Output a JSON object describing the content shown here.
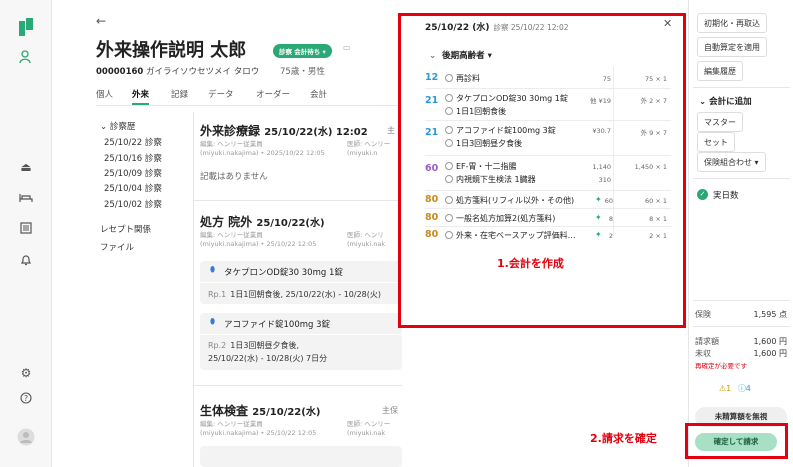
{
  "patient": {
    "back_icon": "←",
    "name": "外来操作説明 太郎",
    "status_badge": "診察 会計待ち ▾",
    "id": "00000160",
    "kana": "ガイライソウセツメイ タロウ",
    "age_sex": "75歳・男性"
  },
  "tabs": [
    "個人",
    "外来",
    "記録",
    "データ",
    "オーダー",
    "会計"
  ],
  "history": {
    "title": "診察歴",
    "items": [
      "25/10/22 診察",
      "25/10/16 診察",
      "25/10/09 診察",
      "25/10/04 診察",
      "25/10/02 診察"
    ],
    "links": [
      "レセプト関係",
      "ファイル"
    ]
  },
  "records": {
    "visit_title": "外来診療録",
    "visit_date": "25/10/22(水) 12:02",
    "visit_meta_left": "編集: ヘンリー従業員\n(miyuki.nakajima) • 2025/10/22 12:05",
    "visit_meta_right": "医師: ヘンリー\n(miyuki.n",
    "visit_trunc": "主",
    "no_record": "記載はありません",
    "rx_title": "処方 院外",
    "rx_date": "25/10/22(水)",
    "rx_meta_left": "編集: ヘンリー従業員\n(miyuki.nakajima) • 25/10/22 12:05",
    "rx_meta_right": "医師: ヘンリ\n(miyuki.nak",
    "rx1_drug": "タケプロンOD錠30 30mg 1錠",
    "rx1_line": "1日1回朝食後, 25/10/22(水) - 10/28(火)",
    "rx1_rp": "Rp.1",
    "rx2_drug": "アコファイド錠100mg 3錠",
    "rx2_rp": "Rp.2",
    "rx2_line1": "1日3回朝昼夕食後,",
    "rx2_line2": "25/10/22(水) - 10/28(火) 7日分",
    "lab_title": "生体検査",
    "lab_date": "25/10/22(水)",
    "lab_meta_left": "編集: ヘンリー従業員\n(miyuki.nakajima) • 25/10/22 12:05",
    "lab_meta_right": "医師: ヘンリー\n(miyuki.nak",
    "lab_trunc": "主保"
  },
  "billing_panel": {
    "date": "25/10/22 (水)",
    "sub": "診察 25/10/22 12:02",
    "close": "✕",
    "insurance": "後期高齢者 ▾",
    "items": [
      {
        "pts": "12",
        "pts_color": "#2b9bd8",
        "name": "再診料",
        "price": "75",
        "mult": "75 × 1"
      },
      {
        "pts": "21",
        "pts_color": "#2b9bd8",
        "name": "タケプロンOD錠30 30mg 1錠",
        "price": "他 ¥19",
        "mult": "外 2 × 7",
        "sub": "1日1回朝食後"
      },
      {
        "pts": "21",
        "pts_color": "#2b9bd8",
        "name": "アコファイド錠100mg 3錠",
        "price": "¥30.7",
        "mult": "外 9 × 7",
        "sub": "1日3回朝昼夕食後"
      },
      {
        "pts": "60",
        "pts_color": "#9a5cc6",
        "name": "EF-胃・十二指腸",
        "price": "1,140",
        "mult": "1,450 × 1",
        "sub": "内視鏡下生検法 1臓器",
        "sub_price": "310"
      },
      {
        "pts": "80",
        "pts_color": "#c88a1a",
        "name": "処方箋料(リフィル以外・その他)",
        "price": "60",
        "mult": "60 × 1",
        "spark": "✦"
      },
      {
        "pts": "80",
        "pts_color": "#c88a1a",
        "name": "一般名処方加算2(処方箋料)",
        "price": "8",
        "mult": "8 × 1",
        "spark": "✦"
      },
      {
        "pts": "80",
        "pts_color": "#c88a1a",
        "name": "外来・在宅ベースアップ評価料…",
        "price": "2",
        "mult": "2 × 1",
        "spark": "✦"
      }
    ],
    "annotation": "1.会計を作成"
  },
  "right": {
    "btn_reset": "初期化・再取込",
    "btn_auto": "自動算定を適用",
    "btn_history": "編集履歴",
    "add_head": "会計に追加",
    "btn_master": "マスター",
    "btn_set": "セット",
    "btn_combo": "保険組合わせ ▾",
    "jitsu": "実日数",
    "ins_label": "保険",
    "ins_value": "1,595 点",
    "bill_label": "請求額",
    "bill_value": "1,600 円",
    "unpaid_label": "未収",
    "unpaid_value": "1,600 円",
    "warn": "再確定が必要です",
    "alert_warn": "⚠1",
    "alert_info": "ⓘ4",
    "btn_unpaid": "未精算額を無視",
    "btn_confirm": "確定して請求",
    "annotation": "2.請求を確定"
  },
  "colors": {
    "accent": "#2aa876",
    "highlight": "#e3000f"
  }
}
